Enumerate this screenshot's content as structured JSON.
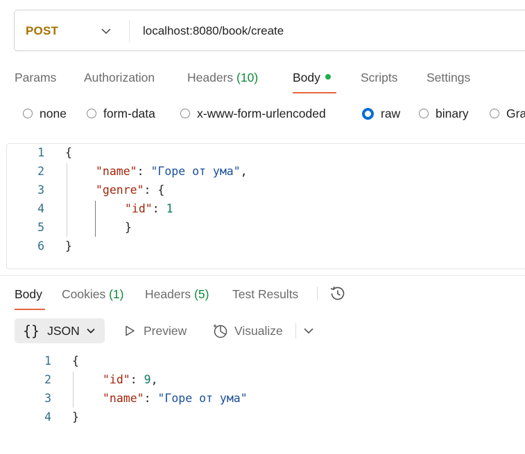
{
  "request": {
    "method": "POST",
    "url": "localhost:8080/book/create"
  },
  "request_tabs": {
    "params": "Params",
    "authorization": "Authorization",
    "headers_label": "Headers",
    "headers_count": "(10)",
    "body": "Body",
    "scripts": "Scripts",
    "settings": "Settings"
  },
  "body_types": {
    "none": "none",
    "form_data": "form-data",
    "urlencoded": "x-www-form-urlencoded",
    "raw": "raw",
    "binary": "binary",
    "graphql": "Gra",
    "selected": "raw"
  },
  "request_body": {
    "line_numbers": [
      "1",
      "2",
      "3",
      "4",
      "5",
      "6"
    ],
    "open_brace": "{",
    "key_name": "\"name\"",
    "colon": ": ",
    "value_name": "\"Горе от ума\"",
    "comma": ",",
    "key_genre": "\"genre\"",
    "genre_open": ": {",
    "key_id": "\"id\"",
    "value_id": "1",
    "inner_close": "}",
    "close_brace": "}"
  },
  "response_tabs": {
    "body": "Body",
    "cookies_label": "Cookies",
    "cookies_count": "(1)",
    "headers_label": "Headers",
    "headers_count": "(5)",
    "test_results": "Test Results"
  },
  "response_toolbar": {
    "format_braces": "{}",
    "format": "JSON",
    "preview": "Preview",
    "visualize": "Visualize"
  },
  "response_body": {
    "line_numbers": [
      "1",
      "2",
      "3",
      "4"
    ],
    "open_brace": "{",
    "key_id": "\"id\"",
    "colon": ": ",
    "value_id": "9",
    "comma": ",",
    "key_name": "\"name\"",
    "value_name": "\"Горе от ума\"",
    "close_brace": "}"
  },
  "colors": {
    "method": "#a47100",
    "accent_underline": "#e8643c",
    "radio_selected": "#0b6bd4",
    "count_green": "#0f8a3c",
    "status_dot": "#1eb04a",
    "json_key": "#a1260d",
    "json_string": "#1a4f9c",
    "json_number": "#0b7a62"
  }
}
